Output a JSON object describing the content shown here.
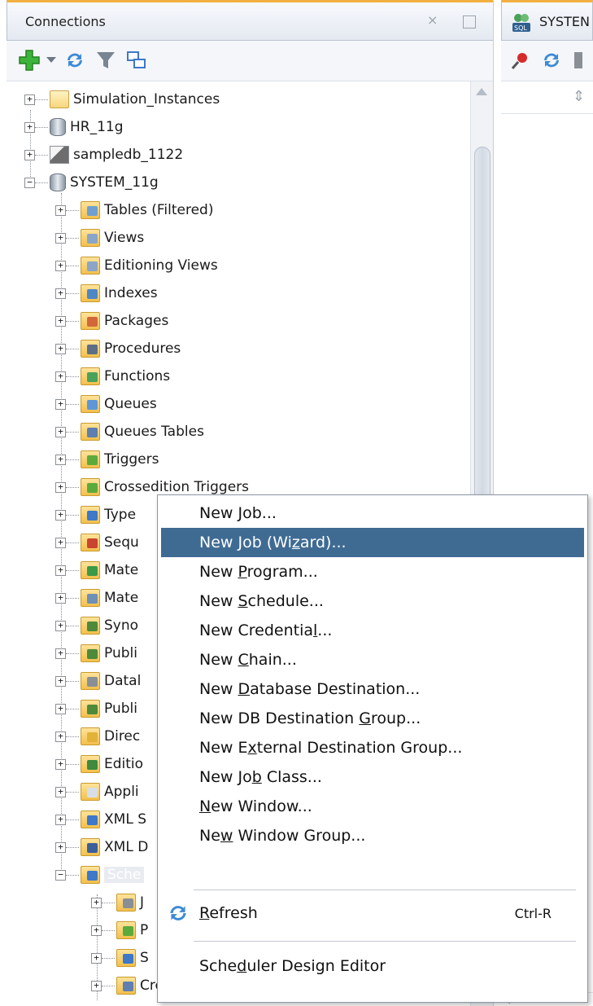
{
  "panel": {
    "title": "Connections",
    "close_glyph": "×",
    "minimize_glyph": "▭"
  },
  "toolbar": {
    "icons": [
      "add-connection-icon",
      "dropdown-arrow-icon",
      "refresh-icon",
      "filter-icon",
      "schema-browser-icon"
    ]
  },
  "tree": {
    "connections": [
      {
        "label": "Simulation_Instances",
        "icon": "folder-icon"
      },
      {
        "label": "HR_11g",
        "icon": "database-icon"
      },
      {
        "label": "sampledb_1122",
        "icon": "database-file-icon"
      },
      {
        "label": "SYSTEM_11g",
        "icon": "database-icon"
      }
    ],
    "children": [
      {
        "label": "Tables (Filtered)",
        "icon": "tables-icon",
        "badge": "#6f9fd0"
      },
      {
        "label": "Views",
        "icon": "views-icon",
        "badge": "#8aa5c7"
      },
      {
        "label": "Editioning Views",
        "icon": "editioning-views-icon",
        "badge": "#8aa5c7"
      },
      {
        "label": "Indexes",
        "icon": "indexes-icon",
        "badge": "#4f86c6"
      },
      {
        "label": "Packages",
        "icon": "packages-icon",
        "badge": "#d2673a"
      },
      {
        "label": "Procedures",
        "icon": "procedures-icon",
        "badge": "#5d6f86"
      },
      {
        "label": "Functions",
        "icon": "functions-icon",
        "badge": "#4aa15a"
      },
      {
        "label": "Queues",
        "icon": "queues-icon",
        "badge": "#5e97d8"
      },
      {
        "label": "Queues Tables",
        "icon": "queues-tables-icon",
        "badge": "#5e7fb0"
      },
      {
        "label": "Triggers",
        "icon": "triggers-icon",
        "badge": "#5caa3c"
      },
      {
        "label": "Crossedition Triggers",
        "icon": "crossedition-triggers-icon",
        "badge": "#5caa3c"
      },
      {
        "label": "Type",
        "icon": "types-icon",
        "badge": "#3d78c9"
      },
      {
        "label": "Sequ",
        "icon": "sequences-icon",
        "badge": "#c9452f"
      },
      {
        "label": "Mate",
        "icon": "materialized-views-icon",
        "badge": "#3a9a48"
      },
      {
        "label": "Mate",
        "icon": "materialized-view-logs-icon",
        "badge": "#6f8fb5"
      },
      {
        "label": "Syno",
        "icon": "synonyms-icon",
        "badge": "#4d8a3a"
      },
      {
        "label": "Publi",
        "icon": "public-synonyms-icon",
        "badge": "#4d8a3a"
      },
      {
        "label": "Datal",
        "icon": "database-links-icon",
        "badge": "#8a8f96"
      },
      {
        "label": "Publi",
        "icon": "public-database-links-icon",
        "badge": "#4d8a3a"
      },
      {
        "label": "Direc",
        "icon": "directories-icon",
        "badge": "#e2b13a"
      },
      {
        "label": "Editio",
        "icon": "editions-icon",
        "badge": "#3f8a3f"
      },
      {
        "label": "Appli",
        "icon": "application-express-icon",
        "badge": "#d7dee7"
      },
      {
        "label": "XML S",
        "icon": "xml-schemas-icon",
        "badge": "#3d78c9"
      },
      {
        "label": "XML D",
        "icon": "xml-db-repository-icon",
        "badge": "#3d5f99"
      },
      {
        "label": "Sche",
        "icon": "scheduler-icon",
        "badge": "#3d78c9"
      }
    ],
    "scheduler_children": [
      {
        "label": "J",
        "icon": "jobs-icon",
        "badge": "#8a8f96"
      },
      {
        "label": "P",
        "icon": "programs-icon",
        "badge": "#5caa3c"
      },
      {
        "label": "S",
        "icon": "schedules-icon",
        "badge": "#3d78c9"
      },
      {
        "label": "Credentials",
        "icon": "credentials-icon",
        "badge": "#5e7fb0"
      }
    ]
  },
  "editor_tab": {
    "title": "SYSTEN",
    "icons": [
      "sql-worksheet-icon",
      "pin-icon",
      "refresh-icon",
      "grid-icon"
    ]
  },
  "context_menu": {
    "items": [
      {
        "pre": "New ",
        "u": "J",
        "post": "ob...",
        "selected": false
      },
      {
        "pre": "New Job (Wi",
        "u": "z",
        "post": "ard)...",
        "selected": true
      },
      {
        "pre": "New ",
        "u": "P",
        "post": "rogram...",
        "selected": false
      },
      {
        "pre": "New ",
        "u": "S",
        "post": "chedule...",
        "selected": false
      },
      {
        "pre": "New Credentia",
        "u": "l",
        "post": "...",
        "selected": false
      },
      {
        "pre": "New ",
        "u": "C",
        "post": "hain...",
        "selected": false
      },
      {
        "pre": "New ",
        "u": "D",
        "post": "atabase Destination...",
        "selected": false
      },
      {
        "pre": "New DB Destination ",
        "u": "G",
        "post": "roup...",
        "selected": false
      },
      {
        "pre": "New E",
        "u": "x",
        "post": "ternal Destination Group...",
        "selected": false
      },
      {
        "pre": "New Jo",
        "u": "b",
        "post": " Class...",
        "selected": false
      },
      {
        "pre": "",
        "u": "N",
        "post": "ew Window...",
        "selected": false
      },
      {
        "pre": "Ne",
        "u": "w",
        "post": " Window Group...",
        "selected": false
      }
    ],
    "refresh": {
      "pre": "",
      "u": "R",
      "post": "efresh",
      "shortcut": "Ctrl-R"
    },
    "design_editor": {
      "pre": "Sche",
      "u": "d",
      "post": "uler Design Editor"
    }
  }
}
